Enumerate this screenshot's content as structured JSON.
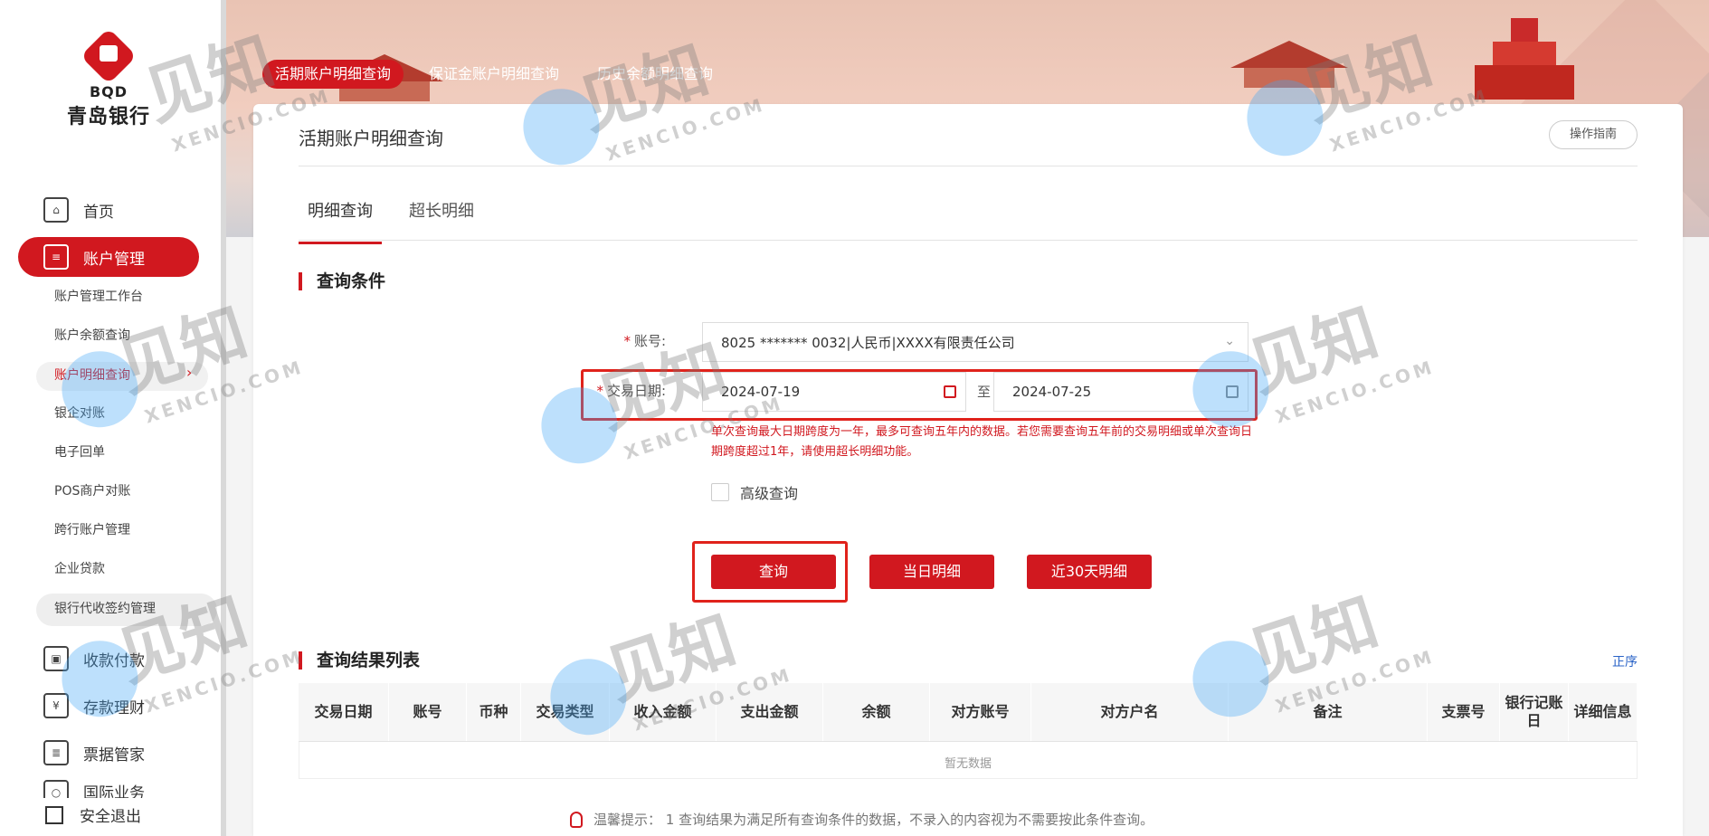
{
  "logo": {
    "abbr": "BQD",
    "name": "青岛银行"
  },
  "nav": [
    {
      "label": "首页",
      "icon": "home-icon",
      "active": false
    },
    {
      "label": "账户管理",
      "icon": "id-card-icon",
      "active": true
    },
    {
      "label": "收款付款",
      "icon": "wallet-icon",
      "active": false
    },
    {
      "label": "存款理财",
      "icon": "deposit-icon",
      "active": false
    },
    {
      "label": "票据管家",
      "icon": "bill-icon",
      "active": false
    },
    {
      "label": "国际业务",
      "icon": "globe-icon",
      "active": false
    }
  ],
  "sub_nav": [
    {
      "label": "账户管理工作台"
    },
    {
      "label": "账户余额查询"
    },
    {
      "label": "账户明细查询",
      "active": true
    },
    {
      "label": "银企对账"
    },
    {
      "label": "电子回单"
    },
    {
      "label": "POS商户对账"
    },
    {
      "label": "跨行账户管理"
    },
    {
      "label": "企业贷款"
    },
    {
      "label": "银行代收签约管理"
    }
  ],
  "logout": "安全退出",
  "top_tabs": [
    {
      "label": "活期账户明细查询",
      "active": true
    },
    {
      "label": "保证金账户明细查询"
    },
    {
      "label": "历史余额明细查询"
    }
  ],
  "card": {
    "title": "活期账户明细查询",
    "guide": "操作指南",
    "sub_tabs": [
      {
        "label": "明细查询",
        "active": true
      },
      {
        "label": "超长明细"
      }
    ]
  },
  "query": {
    "section_title": "查询条件",
    "account_label": "账号:",
    "account_value": "8025 ******* 0032|人民币|XXXX有限责任公司",
    "date_label": "交易日期:",
    "date_from": "2024-07-19",
    "date_to": "2024-07-25",
    "date_sep": "至",
    "hint": "单次查询最大日期跨度为一年，最多可查询五年内的数据。若您需要查询五年前的交易明细或单次查询日期跨度超过1年，请使用超长明细功能。",
    "advanced": "高级查询",
    "buttons": {
      "search": "查询",
      "today": "当日明细",
      "last30": "近30天明细"
    }
  },
  "results": {
    "section_title": "查询结果列表",
    "sort": "正序",
    "columns": [
      "交易日期",
      "账号",
      "币种",
      "交易类型",
      "收入金额",
      "支出金额",
      "余额",
      "对方账号",
      "对方户名",
      "备注",
      "支票号",
      "银行记账日",
      "详细信息"
    ],
    "empty": "暂无数据"
  },
  "tip": "温馨提示：  1 查询结果为满足所有查询条件的数据，不录入的内容视为不需要按此条件查询。",
  "watermark": {
    "cn": "见知",
    "en": "XENCIO.COM"
  },
  "colors": {
    "brand": "#d1181f",
    "link": "#2a63c7"
  }
}
